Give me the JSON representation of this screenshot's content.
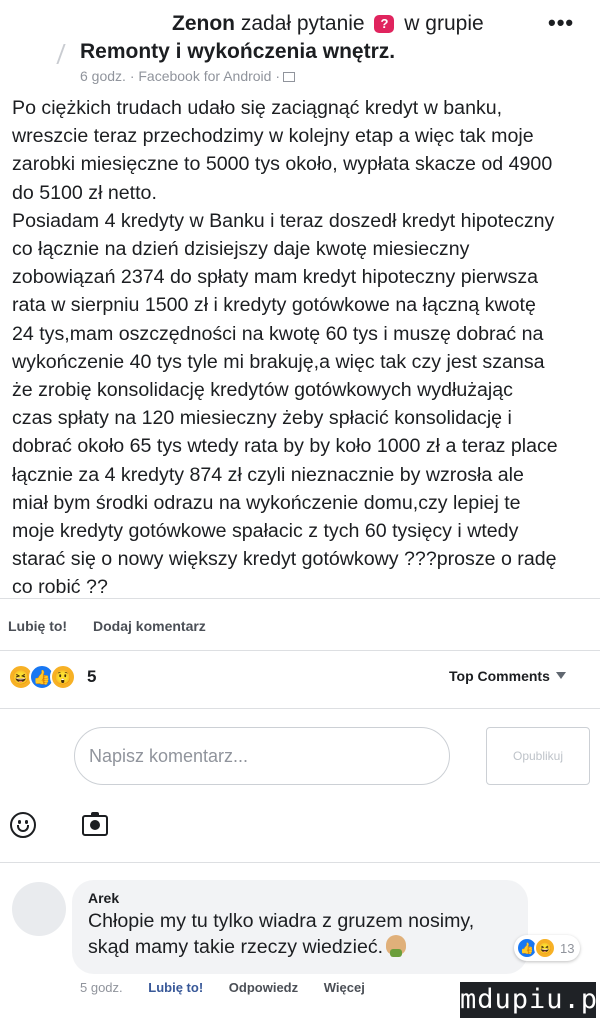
{
  "header": {
    "author": "Zenon",
    "action_text": "zadał pytanie",
    "question_badge": "?",
    "in_group": "w grupie",
    "group_name": "Remonty i wykończenia wnętrz.",
    "meta": "6 godz. · Facebook for Android ·",
    "more_icon": "more-dots-icon"
  },
  "post": {
    "lines": [
      "Po ciężkich trudach udało się zaciągnąć kredyt w banku,",
      "wreszcie teraz przechodzimy w kolejny etap a więc tak moje",
      "zarobki miesięczne to 5000 tys około, wypłata skacze od 4900",
      "do 5100 zł netto.",
      "Posiadam 4 kredyty w Banku i teraz doszedł kredyt hipoteczny",
      "co łącznie na dzień dzisiejszy daje kwotę miesieczny",
      "zobowiązań 2374 do spłaty mam kredyt hipoteczny pierwsza",
      "rata w sierpniu 1500 zł i kredyty gotówkowe na łączną kwotę",
      "24 tys,mam oszczędności na kwotę 60 tys i muszę dobrać na",
      "wykończenie 40 tys tyle mi brakuję,a więc tak czy jest szansa",
      "że zrobię konsolidację kredytów gotówkowych wydłużając",
      "czas spłaty na 120 miesieczny żeby spłacić konsolidację i",
      "dobrać około 65 tys wtedy rata by by koło 1000 zł a teraz place",
      "łącznie za 4 kredyty 874 zł czyli nieznacznie by wzrosła ale",
      "miał bym środki odrazu na wykończenie domu,czy lepiej te",
      "moje kredyty gotówkowe spałacic z tych 60 tysięcy i wtedy",
      "starać się o nowy większy kredyt gotówkowy ???prosze o radę",
      "co robić ??"
    ]
  },
  "actions": {
    "like_label": "Lubię to!",
    "comment_label": "Dodaj komentarz"
  },
  "reactions": {
    "count": "5",
    "icons": [
      "haha-icon",
      "like-icon",
      "wow-icon"
    ]
  },
  "top_comments": {
    "label": "Top Comments"
  },
  "composer": {
    "placeholder": "Napisz komentarz...",
    "publish_label": "Opublikuj"
  },
  "comment": {
    "author": "Arek",
    "line1": "Chłopie my tu tylko wiadra z gruzem nosimy,",
    "line2": "skąd mamy takie rzeczy wiedzieć.",
    "reaction_count": "13",
    "time": "5 godz.",
    "like_label": "Lubię to!",
    "reply_label": "Odpowiedz",
    "more_label": "Więcej"
  },
  "watermark": {
    "text": "mdupiu.pl"
  },
  "colors": {
    "link_blue": "#385898",
    "like_blue": "#1877f2",
    "question_red": "#e0245e",
    "muted_gray": "#90949c"
  }
}
